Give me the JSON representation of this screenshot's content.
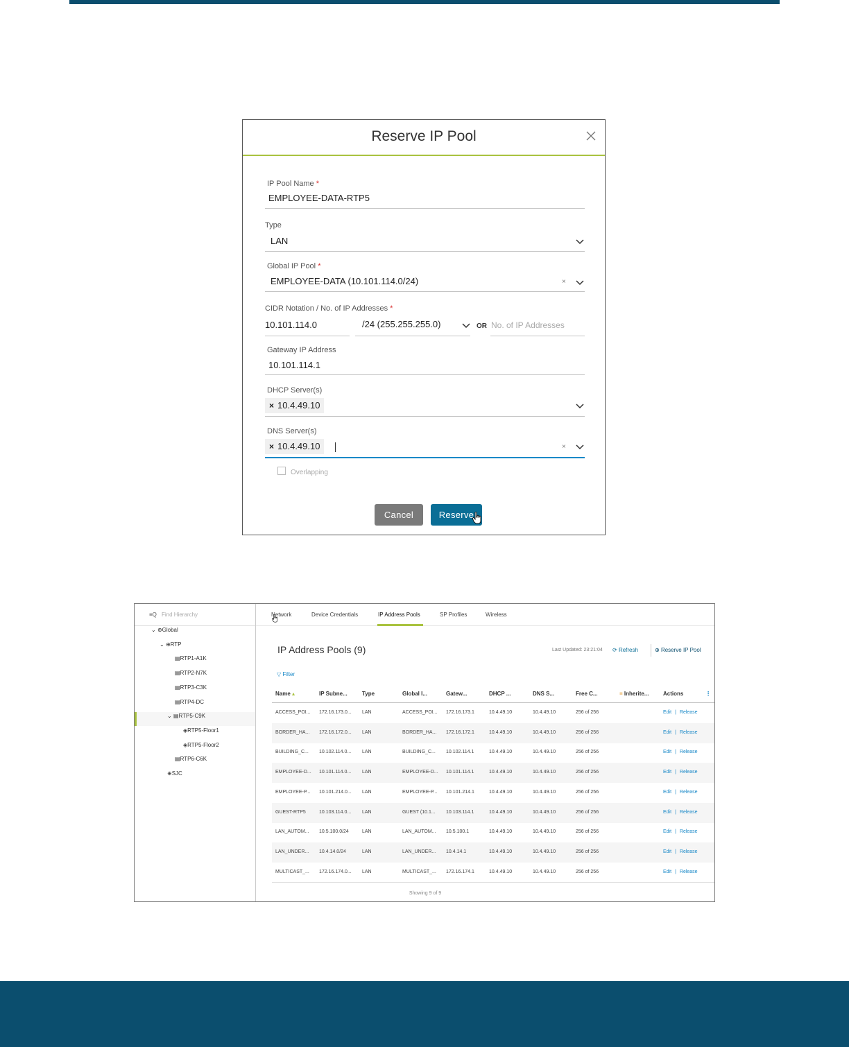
{
  "modal": {
    "title": "Reserve IP Pool",
    "fields": {
      "pool_name": {
        "label": "IP Pool Name",
        "required": "*",
        "value": "EMPLOYEE-DATA-RTP5"
      },
      "type": {
        "label": "Type",
        "value": "LAN"
      },
      "global_pool": {
        "label": "Global IP Pool",
        "required": "*",
        "value": "EMPLOYEE-DATA (10.101.114.0/24)"
      },
      "cidr": {
        "label": "CIDR Notation / No. of IP Addresses",
        "required": "*",
        "address": "10.101.114.0",
        "prefix": "/24 (255.255.255.0)",
        "or": "OR",
        "count_placeholder": "No. of IP Addresses"
      },
      "gateway": {
        "label": "Gateway IP Address",
        "value": "10.101.114.1"
      },
      "dhcp": {
        "label": "DHCP Server(s)",
        "chip": "10.4.49.10"
      },
      "dns": {
        "label": "DNS Server(s)",
        "chip": "10.4.49.10"
      },
      "overlapping": {
        "label": "Overlapping"
      }
    },
    "buttons": {
      "cancel": "Cancel",
      "reserve": "Reserve"
    }
  },
  "panel": {
    "search_placeholder": "Find Hierarchy",
    "tree": [
      {
        "label": "Global",
        "icon": "globe-icon"
      },
      {
        "label": "RTP",
        "icon": "area-icon"
      },
      {
        "label": "RTP1-A1K",
        "icon": "building-icon"
      },
      {
        "label": "RTP2-N7K",
        "icon": "building-icon"
      },
      {
        "label": "RTP3-C3K",
        "icon": "building-icon"
      },
      {
        "label": "RTP4-DC",
        "icon": "building-icon"
      },
      {
        "label": "RTP5-C9K",
        "icon": "building-icon"
      },
      {
        "label": "RTP5-Floor1",
        "icon": "floor-icon"
      },
      {
        "label": "RTP5-Floor2",
        "icon": "floor-icon"
      },
      {
        "label": "RTP6-C6K",
        "icon": "building-icon"
      },
      {
        "label": "SJC",
        "icon": "area-icon"
      }
    ],
    "tabs": [
      "Network",
      "Device Credentials",
      "IP Address Pools",
      "SP Profiles",
      "Wireless"
    ],
    "active_tab": "IP Address Pools",
    "title": "IP Address Pools (9)",
    "last_updated": "Last Updated: 23:21:04",
    "refresh": "Refresh",
    "reserve": "Reserve IP Pool",
    "filter": "Filter",
    "columns": [
      "Name",
      "IP Subne...",
      "Type",
      "Global I...",
      "Gatew...",
      "DHCP ...",
      "DNS S...",
      "Free C...",
      "Inherite...",
      "Actions"
    ],
    "rows": [
      [
        "ACCESS_POI...",
        "172.16.173.0...",
        "LAN",
        "ACCESS_POI...",
        "172.16.173.1",
        "10.4.49.10",
        "10.4.49.10",
        "256 of 256"
      ],
      [
        "BORDER_HA...",
        "172.16.172.0...",
        "LAN",
        "BORDER_HA...",
        "172.16.172.1",
        "10.4.49.10",
        "10.4.49.10",
        "256 of 256"
      ],
      [
        "BUILDING_C...",
        "10.102.114.0...",
        "LAN",
        "BUILDING_C...",
        "10.102.114.1",
        "10.4.49.10",
        "10.4.49.10",
        "256 of 256"
      ],
      [
        "EMPLOYEE-D...",
        "10.101.114.0...",
        "LAN",
        "EMPLOYEE-D...",
        "10.101.114.1",
        "10.4.49.10",
        "10.4.49.10",
        "256 of 256"
      ],
      [
        "EMPLOYEE-P...",
        "10.101.214.0...",
        "LAN",
        "EMPLOYEE-P...",
        "10.101.214.1",
        "10.4.49.10",
        "10.4.49.10",
        "256 of 256"
      ],
      [
        "GUEST-RTP5",
        "10.103.114.0...",
        "LAN",
        "GUEST (10.1...",
        "10.103.114.1",
        "10.4.49.10",
        "10.4.49.10",
        "256 of 256"
      ],
      [
        "LAN_AUTOM...",
        "10.5.100.0/24",
        "LAN",
        "LAN_AUTOM...",
        "10.5.100.1",
        "10.4.49.10",
        "10.4.49.10",
        "256 of 256"
      ],
      [
        "LAN_UNDER...",
        "10.4.14.0/24",
        "LAN",
        "LAN_UNDER...",
        "10.4.14.1",
        "10.4.49.10",
        "10.4.49.10",
        "256 of 256"
      ],
      [
        "MULTICAST_...",
        "172.16.174.0...",
        "LAN",
        "MULTICAST_...",
        "172.16.174.1",
        "10.4.49.10",
        "10.4.49.10",
        "256 of 256"
      ]
    ],
    "action_edit": "Edit",
    "action_release": "Release",
    "action_sep": "|",
    "showing": "Showing 9 of 9"
  },
  "colors": {
    "brand_dark": "#0b4e6e",
    "accent": "#a9c23f",
    "primary_button": "#0a6e96",
    "link": "#1a89c8"
  }
}
